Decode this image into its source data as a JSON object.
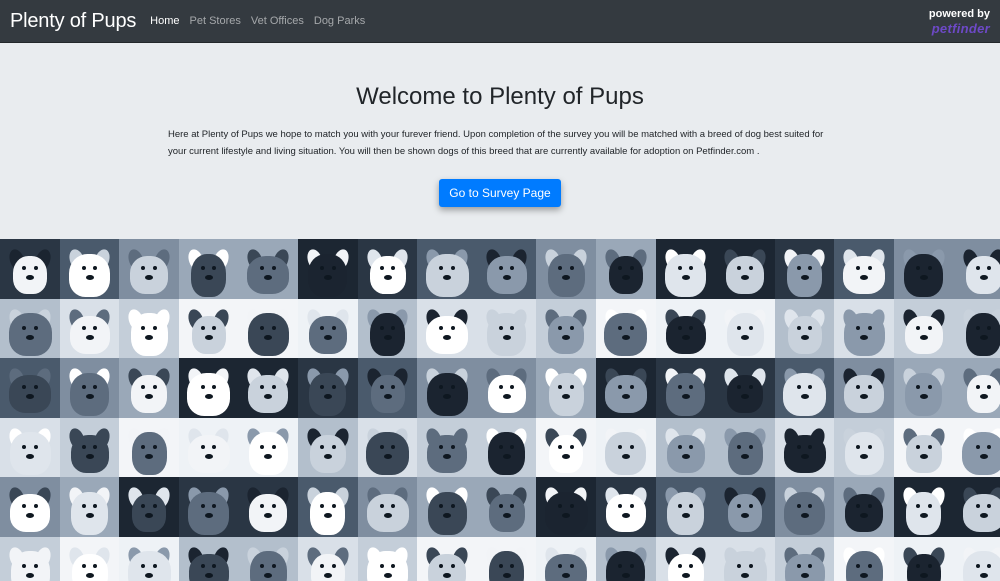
{
  "navbar": {
    "brand": "Plenty of Pups",
    "links": [
      "Home",
      "Pet Stores",
      "Vet Offices",
      "Dog Parks"
    ],
    "active_link": "Home",
    "powered_by": "powered by",
    "powered_logo": "petfinder"
  },
  "jumbotron": {
    "title": "Welcome to Plenty of Pups",
    "intro": "Here at Plenty of Pups we hope to match you with your furever friend. Upon completion of the survey you will be matched with a breed of dog best suited for your current lifestyle and living situation. You will then be shown dogs of this breed that are currently available for adoption on Petfinder.com .",
    "button_label": "Go to Survey Page"
  },
  "colors": {
    "navbar_bg": "#343a40",
    "page_bg": "#e9ecef",
    "button_bg": "#007bff",
    "petfinder_purple": "#6d49c6",
    "mosaic_tint": "#5b6d82"
  },
  "mosaic": {
    "description_icon": "dog-photo-collage",
    "columns": 17,
    "rows": 6
  }
}
